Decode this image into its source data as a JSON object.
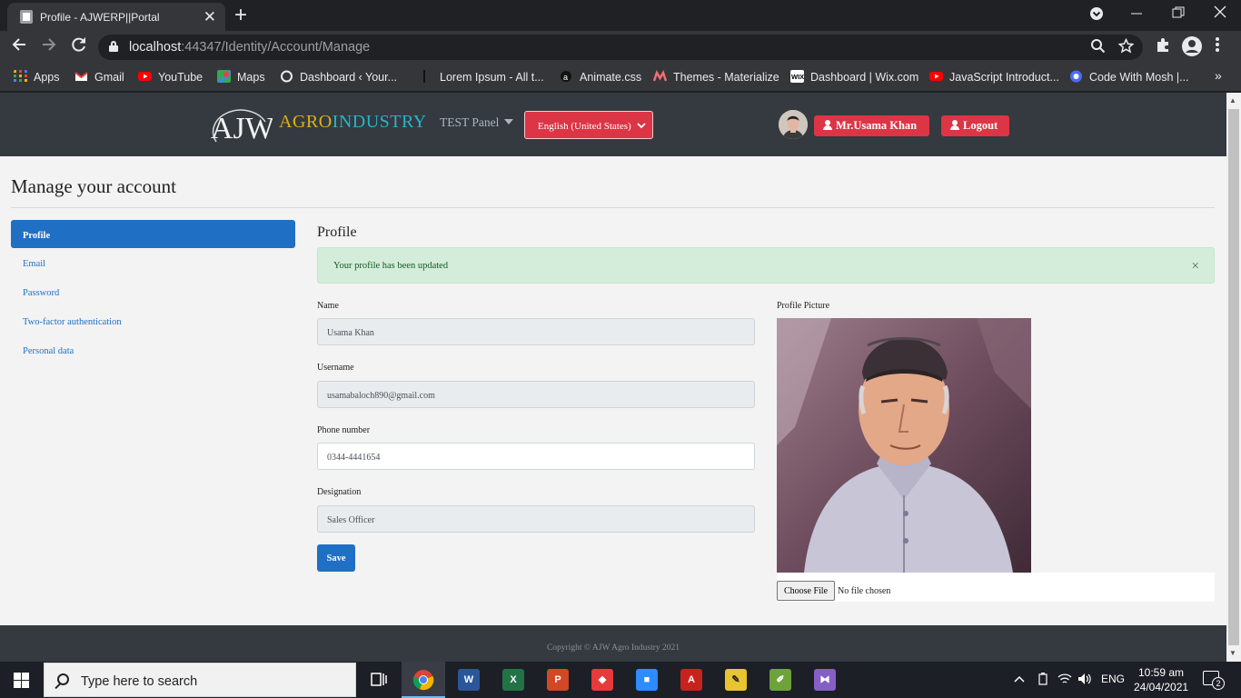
{
  "browser": {
    "tab": {
      "title": "Profile - AJWERP||Portal",
      "close": "✕"
    },
    "new_tab": "+",
    "url": {
      "host": "localhost",
      "rest": ":44347/Identity/Account/Manage"
    },
    "bookmarks": [
      {
        "label": "Apps",
        "color": "#f4b400"
      },
      {
        "label": "Gmail",
        "color": "#ea4335"
      },
      {
        "label": "YouTube",
        "color": "#ff0000"
      },
      {
        "label": "Maps",
        "color": "#34a853"
      },
      {
        "label": "Dashboard ‹ Your...",
        "color": "#e8eaed"
      },
      {
        "label": "Lorem Ipsum - All t...",
        "color": "#35363a"
      },
      {
        "label": "Animate.css",
        "color": "#111111"
      },
      {
        "label": "Themes - Materialize",
        "color": "#ee6e73"
      },
      {
        "label": "Dashboard | Wix.com",
        "color": "#ffffff"
      },
      {
        "label": "JavaScript Introduct...",
        "color": "#ff0000"
      },
      {
        "label": "Code With Mosh |...",
        "color": "#4a6cf7"
      }
    ]
  },
  "header": {
    "logo_mark": "AJW",
    "logo_word_a": "AGRO",
    "logo_word_b": "INDUSTRY",
    "panel": "TEST Panel",
    "language": "English (United States)",
    "user_button": "Mr.Usama Khan",
    "logout_button": "Logout"
  },
  "page": {
    "title": "Manage your account",
    "nav": [
      "Profile",
      "Email",
      "Password",
      "Two-factor authentication",
      "Personal data"
    ],
    "section_title": "Profile",
    "alert": "Your profile has been updated",
    "alert_close": "×",
    "fields": {
      "name_label": "Name",
      "name_value": "Usama Khan",
      "username_label": "Username",
      "username_value": "usamabaloch890@gmail.com",
      "phone_label": "Phone number",
      "phone_value": "0344-4441654",
      "designation_label": "Designation",
      "designation_value": "Sales Officer"
    },
    "save_button": "Save",
    "picture_label": "Profile Picture",
    "choose_file": "Choose File",
    "no_file": "No file chosen",
    "footer": "Copyright © AJW Agro Industry 2021"
  },
  "taskbar": {
    "search_placeholder": "Type here to search",
    "lang": "ENG",
    "time": "10:59 am",
    "date": "24/04/2021",
    "notifications": "2"
  }
}
